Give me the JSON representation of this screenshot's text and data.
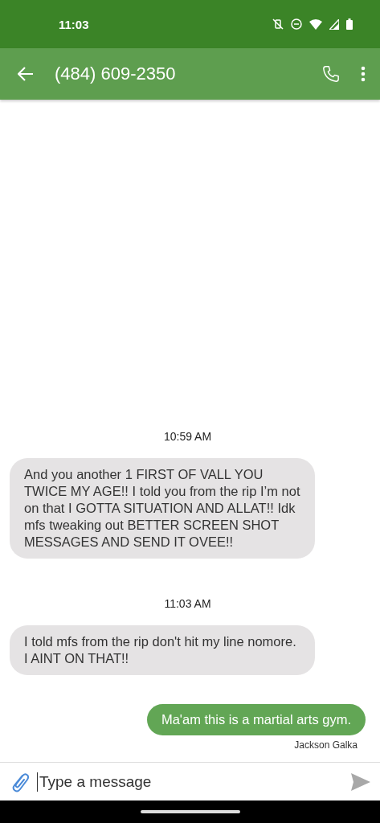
{
  "status_bar": {
    "time": "11:03"
  },
  "app_bar": {
    "title": "(484) 609-2350"
  },
  "messages": [
    {
      "kind": "time",
      "text": "10:59 AM"
    },
    {
      "kind": "received",
      "text": "And you another 1 FIRST OF VALL YOU TWICE MY AGE!! I told you from the rip I’m not on that I GOTTA SITUATION AND ALLAT!! Idk mfs tweaking out BETTER SCREEN SHOT MESSAGES AND SEND IT OVEE!!"
    },
    {
      "kind": "time",
      "text": "11:03 AM"
    },
    {
      "kind": "received",
      "text": "I told mfs from the rip don't hit my line nomore. I AINT ON THAT!!"
    },
    {
      "kind": "sent",
      "text": "Ma'am this is a martial arts gym.",
      "sender": "Jackson Galka"
    }
  ],
  "composer": {
    "placeholder": "Type a message"
  }
}
